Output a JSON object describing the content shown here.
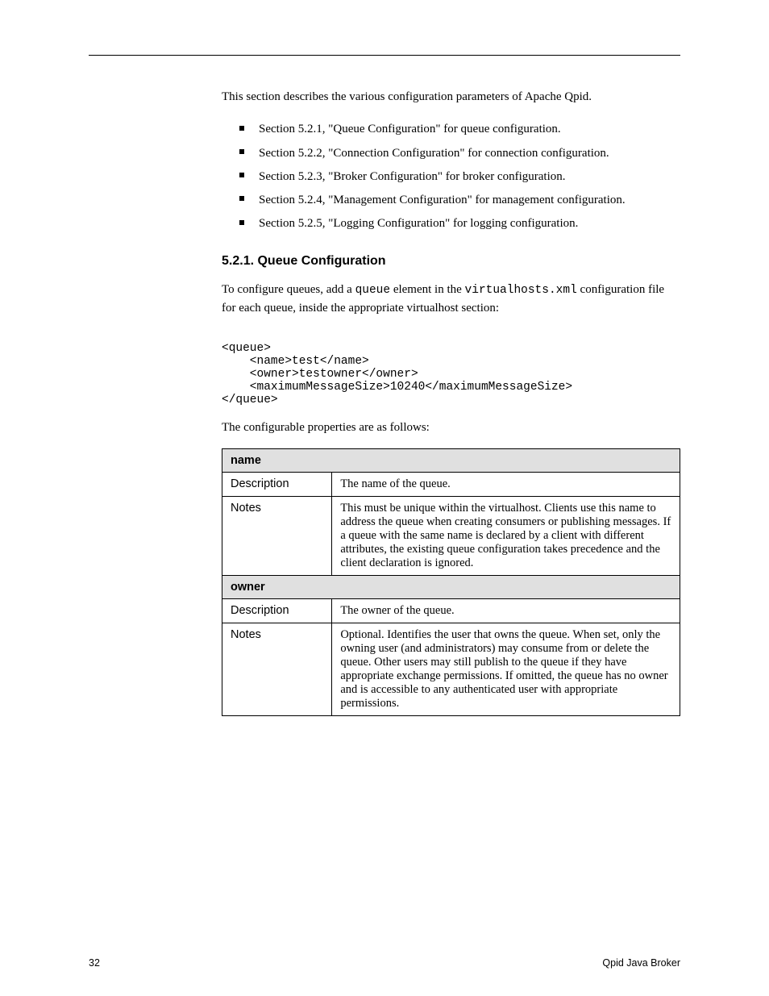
{
  "intro": "This section describes the various configuration parameters of Apache Qpid.",
  "bullets": [
    "Section 5.2.1, \"Queue Configuration\" for queue configuration.",
    "Section 5.2.2, \"Connection Configuration\" for connection configuration.",
    "Section 5.2.3, \"Broker Configuration\" for broker configuration.",
    "Section 5.2.4, \"Management Configuration\" for management configuration.",
    "Section 5.2.5, \"Logging Configuration\" for logging configuration."
  ],
  "queue_heading": "5.2.1. Queue Configuration",
  "queue_para1_prefix": "To configure queues, add a ",
  "queue_para1_code1": "queue",
  "queue_para1_mid": " element in the ",
  "queue_para1_code2": "virtualhosts.xml",
  "queue_para1_suffix": " configuration file for each queue, inside the appropriate virtualhost section:",
  "xml_lines": [
    "<queue>",
    "    <name>test</name>",
    "    <owner>testowner</owner>",
    "    <maximumMessageSize>10240</maximumMessageSize>",
    "</queue>"
  ],
  "queue_para2": "The configurable properties are as follows:",
  "table": {
    "rows": [
      {
        "type": "group",
        "text": "name"
      },
      {
        "type": "attr",
        "label": "Description",
        "value": "The name of the queue."
      },
      {
        "type": "attr",
        "label": "Notes",
        "value_lines": [
          "This must be unique within the virtualhost. Clients use this name to address the queue when creating consumers or publishing messages. If a queue with the same name is declared by a client with different attributes, the existing queue configuration takes precedence and the client declaration is ignored."
        ]
      },
      {
        "type": "group",
        "text": "owner"
      },
      {
        "type": "attr",
        "label": "Description",
        "value": "The owner of the queue."
      },
      {
        "type": "attr",
        "label": "Notes",
        "value_lines": [
          "Optional. Identifies the user that owns the queue. When set, only the owning user (and administrators) may consume from or delete the queue. Other users may still publish to the queue if they have appropriate exchange permissions. If omitted, the queue has no owner and is accessible to any authenticated user with appropriate permissions."
        ]
      }
    ]
  },
  "footer_left": "32",
  "footer_right": "Qpid Java Broker"
}
